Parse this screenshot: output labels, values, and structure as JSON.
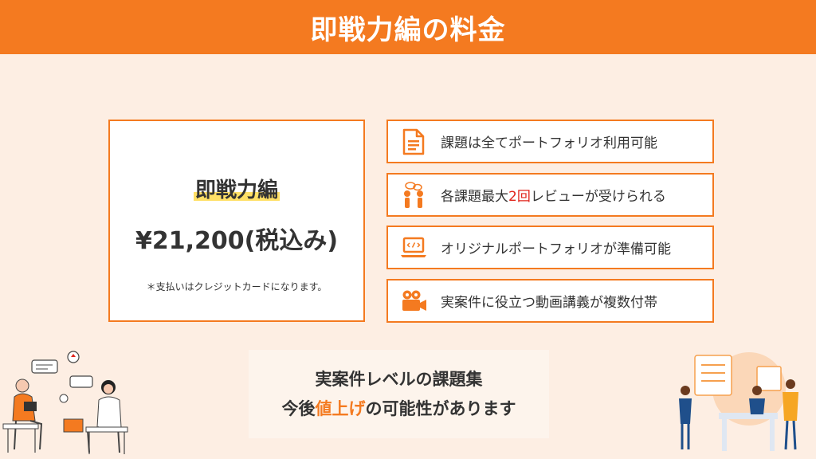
{
  "header": {
    "title": "即戦力編の料金"
  },
  "price_card": {
    "course_name": "即戦力編",
    "price": "¥21,200(税込み)",
    "note": "＊支払いはクレジットカードになります。"
  },
  "features": [
    {
      "icon": "document-icon",
      "text": "課題は全てポートフォリオ利用可能"
    },
    {
      "icon": "review-people-icon",
      "pre": "各課題最大",
      "em": "2回",
      "post": "レビューが受けられる"
    },
    {
      "icon": "laptop-code-icon",
      "text": "オリジナルポートフォリオが準備可能"
    },
    {
      "icon": "video-camera-icon",
      "text": "実案件に役立つ動画講義が複数付帯"
    }
  ],
  "bottom": {
    "line1": "実案件レベルの課題集",
    "line2_pre": "今後",
    "line2_hl": "値上げ",
    "line2_post": "の可能性があります"
  },
  "colors": {
    "accent": "#f47a20",
    "background": "#fdeee3",
    "emphasis": "#e0241b",
    "highlight": "#ffe066"
  }
}
